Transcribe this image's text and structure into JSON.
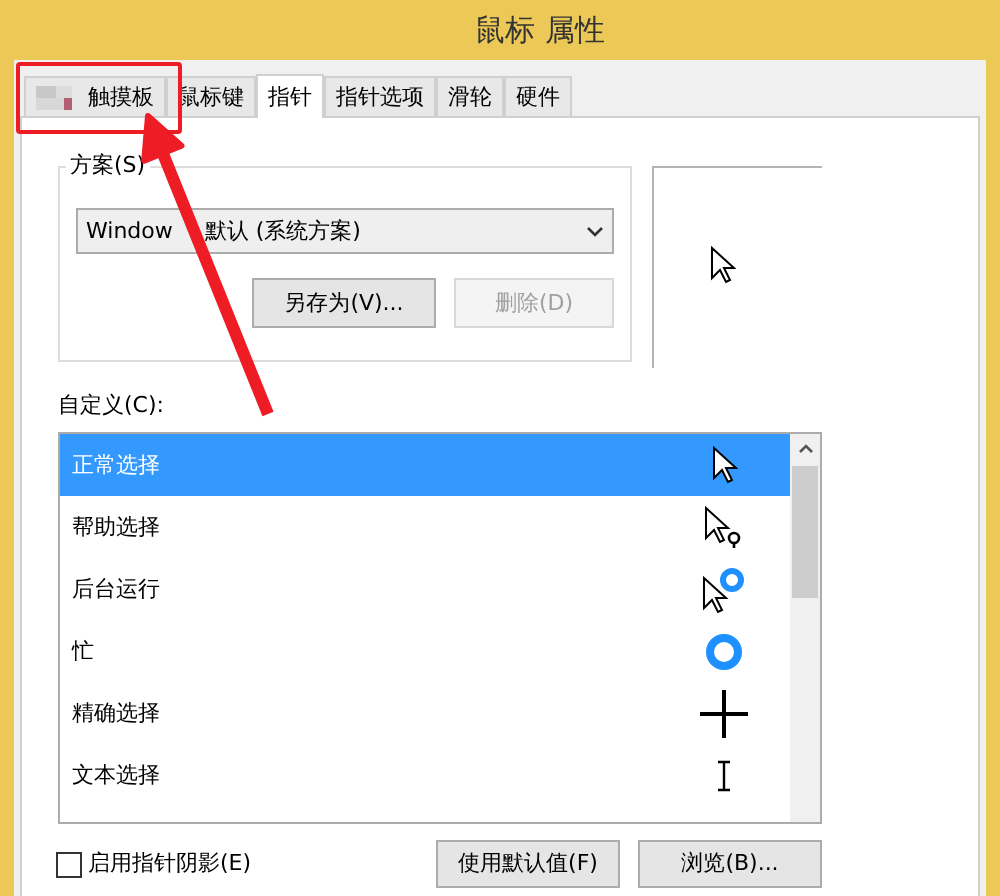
{
  "window": {
    "title": "鼠标 属性"
  },
  "tabs": [
    {
      "label": "触摸板",
      "selected": false,
      "icon": true
    },
    {
      "label": "鼠标键",
      "selected": false
    },
    {
      "label": "指针",
      "selected": true
    },
    {
      "label": "指针选项",
      "selected": false
    },
    {
      "label": "滑轮",
      "selected": false
    },
    {
      "label": "硬件",
      "selected": false
    }
  ],
  "scheme": {
    "legend": "方案(S)",
    "value_parts": [
      "Window",
      "默认 (系统方案)"
    ],
    "buttons": [
      {
        "label": "另存为(V)...",
        "disabled": false
      },
      {
        "label": "删除(D)",
        "disabled": true
      }
    ]
  },
  "customize": {
    "label": "自定义(C):",
    "rows": [
      {
        "label": "正常选择",
        "kind": "arrow",
        "selected": true
      },
      {
        "label": "帮助选择",
        "kind": "help",
        "selected": false
      },
      {
        "label": "后台运行",
        "kind": "working",
        "selected": false
      },
      {
        "label": "忙",
        "kind": "busy",
        "selected": false
      },
      {
        "label": "精确选择",
        "kind": "cross",
        "selected": false
      },
      {
        "label": "文本选择",
        "kind": "text",
        "selected": false
      }
    ]
  },
  "shadow": {
    "label": "启用指针阴影(E)",
    "checked": false
  },
  "buttons": [
    {
      "label": "使用默认值(F)"
    },
    {
      "label": "浏览(B)..."
    }
  ]
}
